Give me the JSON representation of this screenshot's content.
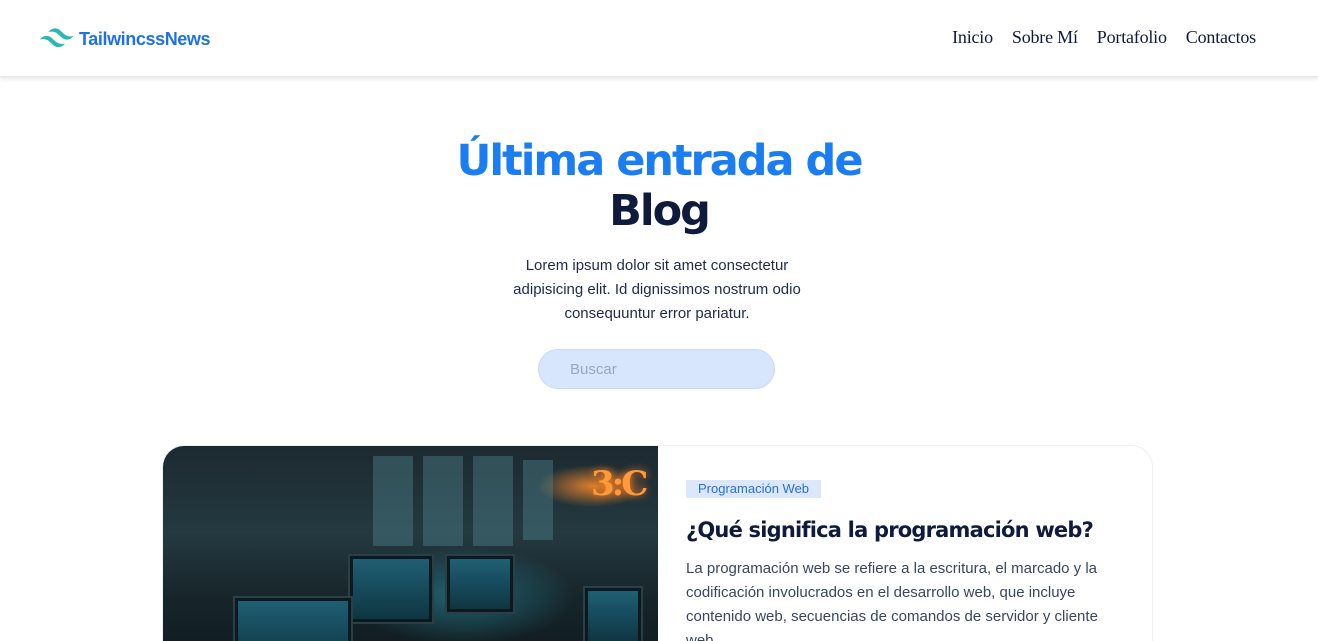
{
  "brand": {
    "name": "TailwincssNews",
    "logo_icon": "tailwind-wave-icon",
    "accent": "#1a7ef2"
  },
  "nav": {
    "items": [
      {
        "label": "Inicio"
      },
      {
        "label": "Sobre Mí"
      },
      {
        "label": "Portafolio"
      },
      {
        "label": "Contactos"
      }
    ]
  },
  "hero": {
    "title_line1": "Última entrada de",
    "title_line2": "Blog",
    "description": "Lorem ipsum dolor sit amet consectetur adipisicing elit. Id dignissimos nostrum odio consequuntur error pariatur."
  },
  "search": {
    "placeholder": "Buscar",
    "value": ""
  },
  "post": {
    "category": "Programación Web",
    "title": "¿Qué significa la programación web?",
    "excerpt": "La programación web se refiere a la escritura, el marcado y la codificación involucrados en el desarrollo web, que incluye contenido web, secuencias de comandos de servidor y cliente web.",
    "image_alt_icon": "workspace-photo"
  }
}
